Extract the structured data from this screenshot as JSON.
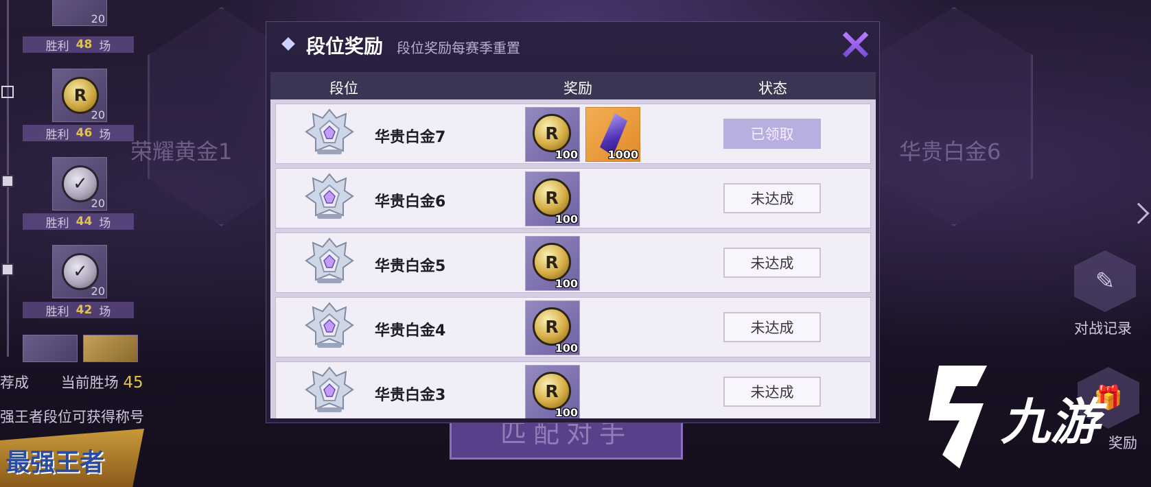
{
  "background": {
    "win_rows": [
      {
        "prefix": "胜利",
        "count": "48",
        "suffix": "场"
      },
      {
        "prefix": "胜利",
        "count": "46",
        "suffix": "场"
      },
      {
        "prefix": "胜利",
        "count": "44",
        "suffix": "场"
      },
      {
        "prefix": "胜利",
        "count": "42",
        "suffix": "场"
      }
    ],
    "item_counts": [
      "20",
      "20",
      "20",
      "20"
    ],
    "coin_glyph": "R",
    "check_glyph": "✓",
    "current_wins_label": "当前胜场",
    "current_wins_value": "45",
    "current_wins_prefix": "荐成",
    "title_hint": "强王者段位可获得称号",
    "left_rank_title": "荣耀黄金1",
    "right_rank_title": "华贵白金6",
    "logo_text": "最强王者",
    "match_button": "匹配对手",
    "battle_record_label": "对战记录",
    "reward_side_label": "奖励",
    "watermark_text": "九游"
  },
  "modal": {
    "title": "段位奖励",
    "subtitle": "段位奖励每赛季重置",
    "close_label": "×",
    "columns": {
      "rank": "段位",
      "reward": "奖励",
      "status": "状态"
    },
    "rows": [
      {
        "rank": "华贵白金7",
        "rewards": [
          {
            "type": "coin",
            "glyph": "R",
            "qty": "100"
          },
          {
            "type": "shard",
            "qty": "1000"
          }
        ],
        "status": "已领取",
        "claimed": true
      },
      {
        "rank": "华贵白金6",
        "rewards": [
          {
            "type": "coin",
            "glyph": "R",
            "qty": "100"
          }
        ],
        "status": "未达成",
        "claimed": false
      },
      {
        "rank": "华贵白金5",
        "rewards": [
          {
            "type": "coin",
            "glyph": "R",
            "qty": "100"
          }
        ],
        "status": "未达成",
        "claimed": false
      },
      {
        "rank": "华贵白金4",
        "rewards": [
          {
            "type": "coin",
            "glyph": "R",
            "qty": "100"
          }
        ],
        "status": "未达成",
        "claimed": false
      },
      {
        "rank": "华贵白金3",
        "rewards": [
          {
            "type": "coin",
            "glyph": "R",
            "qty": "100"
          }
        ],
        "status": "未达成",
        "claimed": false
      }
    ]
  },
  "colors": {
    "accent": "#b67cff",
    "claimed_button": "#b9aee0",
    "header_bar": "#3b3453",
    "row_background": "#f1eef8",
    "win_number": "#e3c24c"
  }
}
